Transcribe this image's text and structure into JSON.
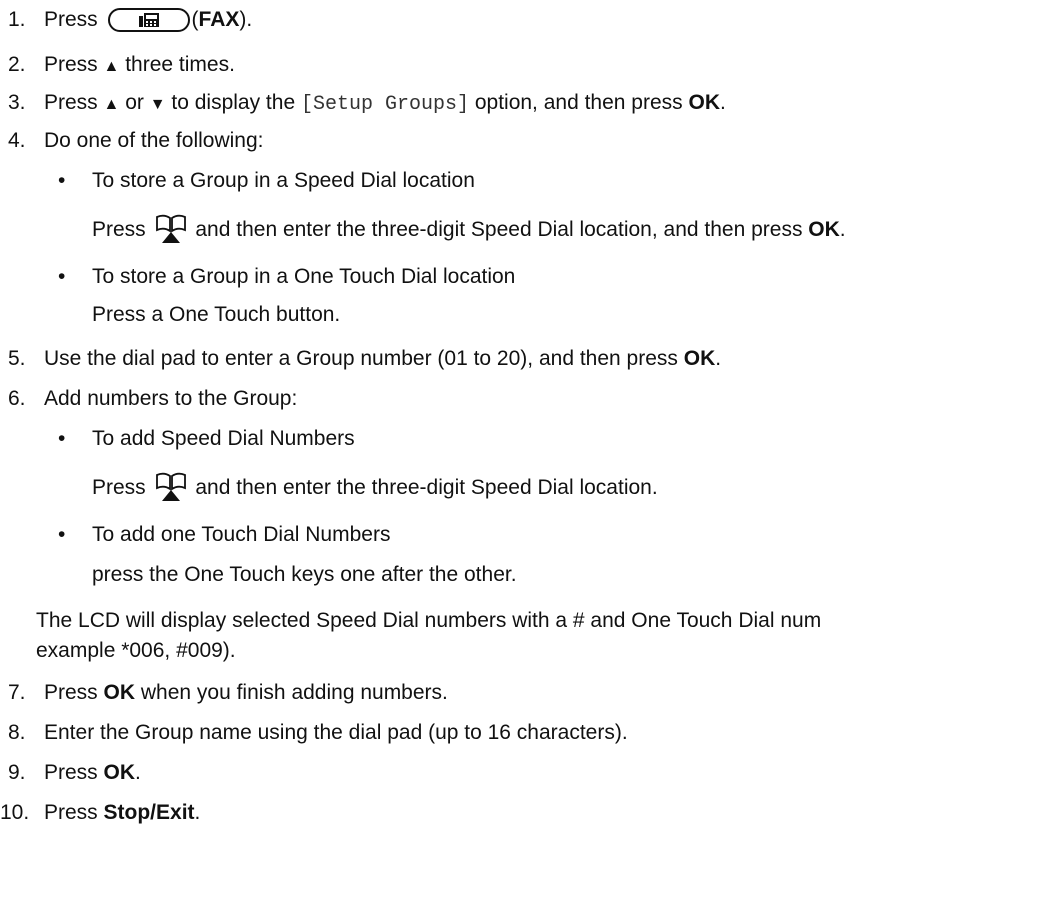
{
  "steps": [
    {
      "num": "1.",
      "pre": "Press",
      "post_open": "(",
      "bold": "FAX",
      "post_close": ")."
    },
    {
      "num": "2.",
      "text_a": "Press ",
      "arrow_up": "▲",
      "text_b": " three times."
    },
    {
      "num": "3.",
      "text_a": "Press ",
      "arrow_up": "▲",
      "or": " or ",
      "arrow_down": "▼",
      "text_b": " to display the ",
      "code": "[Setup Groups]",
      "text_c": " option, and then press ",
      "bold": "OK",
      "end": "."
    },
    {
      "num": "4.",
      "text": "Do one of the following:"
    },
    {
      "num": "5.",
      "text": "Use the dial pad to enter a Group number (01 to 20), and then press ",
      "bold": "OK",
      "end": "."
    },
    {
      "num": "6.",
      "text": "Add numbers to the Group:"
    },
    {
      "num": "7.",
      "pre": "Press ",
      "bold": "OK",
      "text": " when you finish adding numbers."
    },
    {
      "num": "8.",
      "text": "Enter the Group name using the dial pad (up to 16 characters)."
    },
    {
      "num": "9.",
      "pre": "Press ",
      "bold": "OK",
      "end": "."
    },
    {
      "num": "10.",
      "pre": "Press ",
      "bold": "Stop/Exit",
      "end": "."
    }
  ],
  "step4": {
    "bullet_char": "•",
    "option1_title": "To store a Group in a Speed Dial location",
    "option1_pre": "Press",
    "option1_text": "and then enter the three-digit Speed Dial location, and then press ",
    "option1_bold": "OK",
    "option1_end": ".",
    "option2_title": "To store a Group in a One Touch Dial location",
    "option2_text": "Press a One Touch button."
  },
  "step6": {
    "option1_title": "To add Speed Dial Numbers",
    "option1_pre": "Press",
    "option1_text": "and then enter the three-digit Speed Dial location.",
    "option2_title": "To add one Touch Dial Numbers",
    "option2_text": "press the One Touch keys one after the other.",
    "note_line1": "The LCD will display selected Speed Dial numbers with a # and One Touch Dial num",
    "note_line2": "example *006, #009)."
  },
  "icons": {
    "fax_key": "fax-machine-icon",
    "address_book": "address-book-icon"
  }
}
